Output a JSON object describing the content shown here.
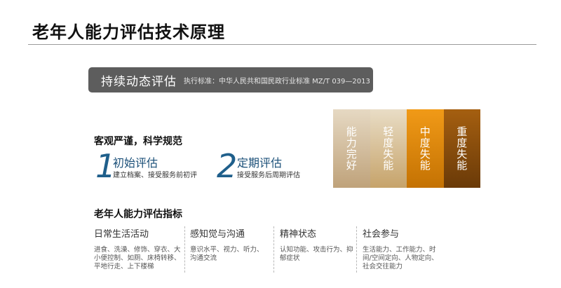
{
  "page": {
    "title": "老年人能力评估技术原理"
  },
  "banner": {
    "title": "持续动态评估",
    "standard": "执行标准：中华人民共和国民政行业标准 MZ/T 039—2013"
  },
  "principle": {
    "heading": "客观严谨，科学规范",
    "steps": [
      {
        "number": "1",
        "title": "初始评估",
        "subtitle": "建立档案、接受服务前初评"
      },
      {
        "number": "2",
        "title": "定期评估",
        "subtitle": "接受服务后周期评估"
      }
    ]
  },
  "levels": [
    {
      "label": "能力完好",
      "color": "#d8c4a2"
    },
    {
      "label": "轻度失能",
      "color": "#d9b98a"
    },
    {
      "label": "中度失能",
      "color": "#e0870b"
    },
    {
      "label": "重度失能",
      "color": "#86490c"
    }
  ],
  "indicators": {
    "heading": "老年人能力评估指标",
    "categories": [
      {
        "title": "日常生活活动",
        "desc": "进食、洗澡、修饰、穿衣、大小便控制、如厕、床椅转移、平地行走、上下楼梯"
      },
      {
        "title": "感知觉与沟通",
        "desc": "意识水平、视力、听力、沟通交流"
      },
      {
        "title": "精神状态",
        "desc": "认知功能、攻击行为、抑郁症状"
      },
      {
        "title": "社会参与",
        "desc": "生活能力、工作能力、时间/空间定向、人物定向、社会交往能力"
      }
    ]
  }
}
